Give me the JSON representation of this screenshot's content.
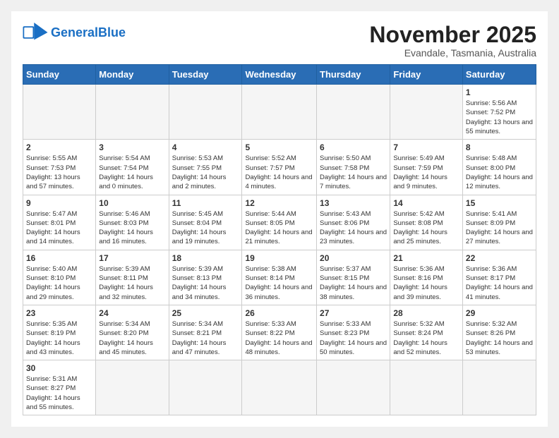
{
  "logo": {
    "general": "General",
    "blue": "Blue"
  },
  "header": {
    "month": "November 2025",
    "location": "Evandale, Tasmania, Australia"
  },
  "days_of_week": [
    "Sunday",
    "Monday",
    "Tuesday",
    "Wednesday",
    "Thursday",
    "Friday",
    "Saturday"
  ],
  "weeks": [
    [
      {
        "day": "",
        "info": ""
      },
      {
        "day": "",
        "info": ""
      },
      {
        "day": "",
        "info": ""
      },
      {
        "day": "",
        "info": ""
      },
      {
        "day": "",
        "info": ""
      },
      {
        "day": "",
        "info": ""
      },
      {
        "day": "1",
        "info": "Sunrise: 5:56 AM\nSunset: 7:52 PM\nDaylight: 13 hours and 55 minutes."
      }
    ],
    [
      {
        "day": "2",
        "info": "Sunrise: 5:55 AM\nSunset: 7:53 PM\nDaylight: 13 hours and 57 minutes."
      },
      {
        "day": "3",
        "info": "Sunrise: 5:54 AM\nSunset: 7:54 PM\nDaylight: 14 hours and 0 minutes."
      },
      {
        "day": "4",
        "info": "Sunrise: 5:53 AM\nSunset: 7:55 PM\nDaylight: 14 hours and 2 minutes."
      },
      {
        "day": "5",
        "info": "Sunrise: 5:52 AM\nSunset: 7:57 PM\nDaylight: 14 hours and 4 minutes."
      },
      {
        "day": "6",
        "info": "Sunrise: 5:50 AM\nSunset: 7:58 PM\nDaylight: 14 hours and 7 minutes."
      },
      {
        "day": "7",
        "info": "Sunrise: 5:49 AM\nSunset: 7:59 PM\nDaylight: 14 hours and 9 minutes."
      },
      {
        "day": "8",
        "info": "Sunrise: 5:48 AM\nSunset: 8:00 PM\nDaylight: 14 hours and 12 minutes."
      }
    ],
    [
      {
        "day": "9",
        "info": "Sunrise: 5:47 AM\nSunset: 8:01 PM\nDaylight: 14 hours and 14 minutes."
      },
      {
        "day": "10",
        "info": "Sunrise: 5:46 AM\nSunset: 8:03 PM\nDaylight: 14 hours and 16 minutes."
      },
      {
        "day": "11",
        "info": "Sunrise: 5:45 AM\nSunset: 8:04 PM\nDaylight: 14 hours and 19 minutes."
      },
      {
        "day": "12",
        "info": "Sunrise: 5:44 AM\nSunset: 8:05 PM\nDaylight: 14 hours and 21 minutes."
      },
      {
        "day": "13",
        "info": "Sunrise: 5:43 AM\nSunset: 8:06 PM\nDaylight: 14 hours and 23 minutes."
      },
      {
        "day": "14",
        "info": "Sunrise: 5:42 AM\nSunset: 8:08 PM\nDaylight: 14 hours and 25 minutes."
      },
      {
        "day": "15",
        "info": "Sunrise: 5:41 AM\nSunset: 8:09 PM\nDaylight: 14 hours and 27 minutes."
      }
    ],
    [
      {
        "day": "16",
        "info": "Sunrise: 5:40 AM\nSunset: 8:10 PM\nDaylight: 14 hours and 29 minutes."
      },
      {
        "day": "17",
        "info": "Sunrise: 5:39 AM\nSunset: 8:11 PM\nDaylight: 14 hours and 32 minutes."
      },
      {
        "day": "18",
        "info": "Sunrise: 5:39 AM\nSunset: 8:13 PM\nDaylight: 14 hours and 34 minutes."
      },
      {
        "day": "19",
        "info": "Sunrise: 5:38 AM\nSunset: 8:14 PM\nDaylight: 14 hours and 36 minutes."
      },
      {
        "day": "20",
        "info": "Sunrise: 5:37 AM\nSunset: 8:15 PM\nDaylight: 14 hours and 38 minutes."
      },
      {
        "day": "21",
        "info": "Sunrise: 5:36 AM\nSunset: 8:16 PM\nDaylight: 14 hours and 39 minutes."
      },
      {
        "day": "22",
        "info": "Sunrise: 5:36 AM\nSunset: 8:17 PM\nDaylight: 14 hours and 41 minutes."
      }
    ],
    [
      {
        "day": "23",
        "info": "Sunrise: 5:35 AM\nSunset: 8:19 PM\nDaylight: 14 hours and 43 minutes."
      },
      {
        "day": "24",
        "info": "Sunrise: 5:34 AM\nSunset: 8:20 PM\nDaylight: 14 hours and 45 minutes."
      },
      {
        "day": "25",
        "info": "Sunrise: 5:34 AM\nSunset: 8:21 PM\nDaylight: 14 hours and 47 minutes."
      },
      {
        "day": "26",
        "info": "Sunrise: 5:33 AM\nSunset: 8:22 PM\nDaylight: 14 hours and 48 minutes."
      },
      {
        "day": "27",
        "info": "Sunrise: 5:33 AM\nSunset: 8:23 PM\nDaylight: 14 hours and 50 minutes."
      },
      {
        "day": "28",
        "info": "Sunrise: 5:32 AM\nSunset: 8:24 PM\nDaylight: 14 hours and 52 minutes."
      },
      {
        "day": "29",
        "info": "Sunrise: 5:32 AM\nSunset: 8:26 PM\nDaylight: 14 hours and 53 minutes."
      }
    ],
    [
      {
        "day": "30",
        "info": "Sunrise: 5:31 AM\nSunset: 8:27 PM\nDaylight: 14 hours and 55 minutes."
      },
      {
        "day": "",
        "info": ""
      },
      {
        "day": "",
        "info": ""
      },
      {
        "day": "",
        "info": ""
      },
      {
        "day": "",
        "info": ""
      },
      {
        "day": "",
        "info": ""
      },
      {
        "day": "",
        "info": ""
      }
    ]
  ]
}
